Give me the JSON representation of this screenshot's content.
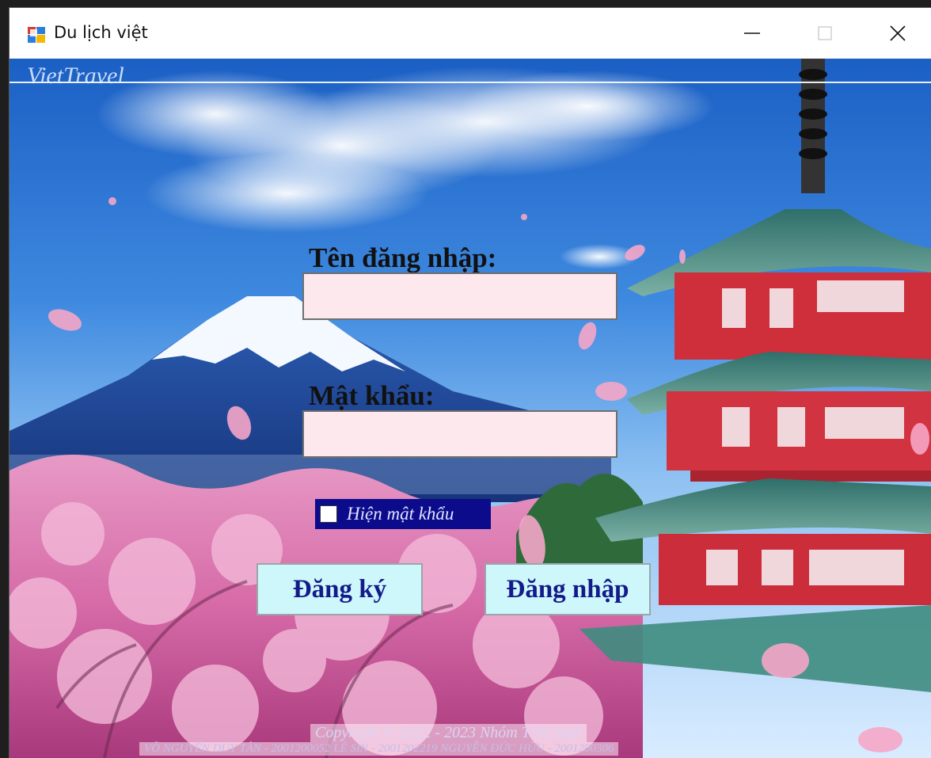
{
  "window": {
    "title": "Du lịch việt"
  },
  "group": {
    "legend": "VietTravel"
  },
  "form": {
    "username_label": "Tên đăng nhập:",
    "username_value": "",
    "password_label": "Mật khẩu:",
    "password_value": "",
    "show_password_label": "Hiện mật khẩu",
    "show_password_checked": false,
    "register_button": "Đăng ký",
    "login_button": "Đăng nhập"
  },
  "footer": {
    "copyright": "Copyright © 2022 - 2023 Nhóm TSH.Hufi",
    "authors": "VÕ NGUYỄN DUY TÂN - 2001200052  LÊ SIN - 2001202219  NGUYỄN ĐỨC HỮU - 2001200306"
  },
  "colors": {
    "field_bg": "#fde8ee",
    "button_bg": "#cdf7fb",
    "button_text": "#141a8a",
    "checkbox_bg": "#0b0b8c"
  },
  "icons": [
    "app-icon",
    "minimize-icon",
    "maximize-icon",
    "close-icon"
  ]
}
